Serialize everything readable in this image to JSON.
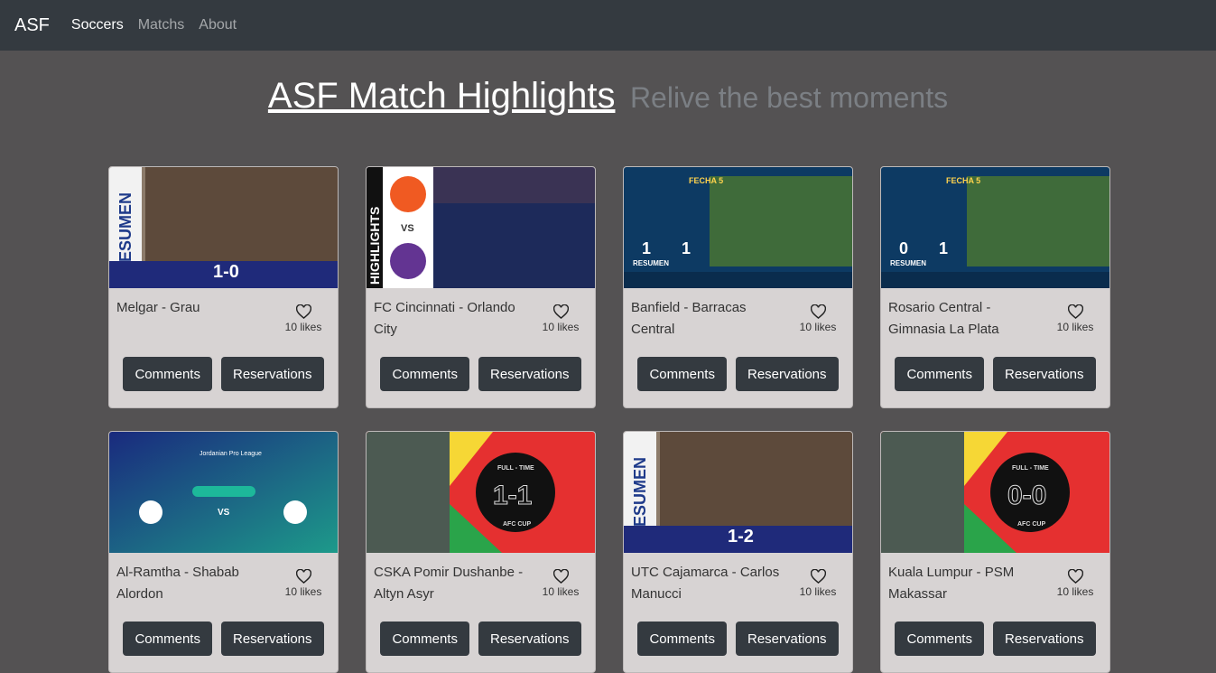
{
  "nav": {
    "brand": "ASF",
    "links": [
      "Soccers",
      "Matchs",
      "About"
    ]
  },
  "hero": {
    "title": "ASF Match Highlights",
    "subtitle": "Relive the best moments"
  },
  "buttons": {
    "comments": "Comments",
    "reservations": "Reservations"
  },
  "cards": [
    {
      "title": "Melgar - Grau",
      "likes": "10 likes",
      "thumb": {
        "style": "resumen",
        "score": "1-0"
      }
    },
    {
      "title": "FC Cincinnati - Orlando City",
      "likes": "10 likes",
      "thumb": {
        "style": "highlights",
        "side_text": "HIGHLIGHTS",
        "vs": "VS"
      }
    },
    {
      "title": "Banfield - Barracas Central",
      "likes": "10 likes",
      "thumb": {
        "style": "torneo",
        "header": "FECHA 5",
        "score_home": "1",
        "score_away": "1",
        "label": "RESUMEN"
      }
    },
    {
      "title": "Rosario Central - Gimnasia La Plata",
      "likes": "10 likes",
      "thumb": {
        "style": "torneo",
        "header": "FECHA 5",
        "score_home": "0",
        "score_away": "1",
        "label": "RESUMEN"
      }
    },
    {
      "title": "Al-Ramtha - Shabab Alordon",
      "likes": "10 likes",
      "thumb": {
        "style": "jordan",
        "league": "Jordanian Pro League",
        "vs": "VS"
      }
    },
    {
      "title": "CSKA Pomir Dushanbe - Altyn Asyr",
      "likes": "10 likes",
      "thumb": {
        "style": "afc",
        "header": "FULL - TIME",
        "score": "1-1",
        "footer": "AFC CUP"
      }
    },
    {
      "title": "UTC Cajamarca - Carlos Manucci",
      "likes": "10 likes",
      "thumb": {
        "style": "resumen",
        "score": "1-2"
      }
    },
    {
      "title": "Kuala Lumpur - PSM Makassar",
      "likes": "10 likes",
      "thumb": {
        "style": "afc",
        "header": "FULL - TIME",
        "score": "0-0",
        "footer": "AFC CUP"
      }
    }
  ]
}
